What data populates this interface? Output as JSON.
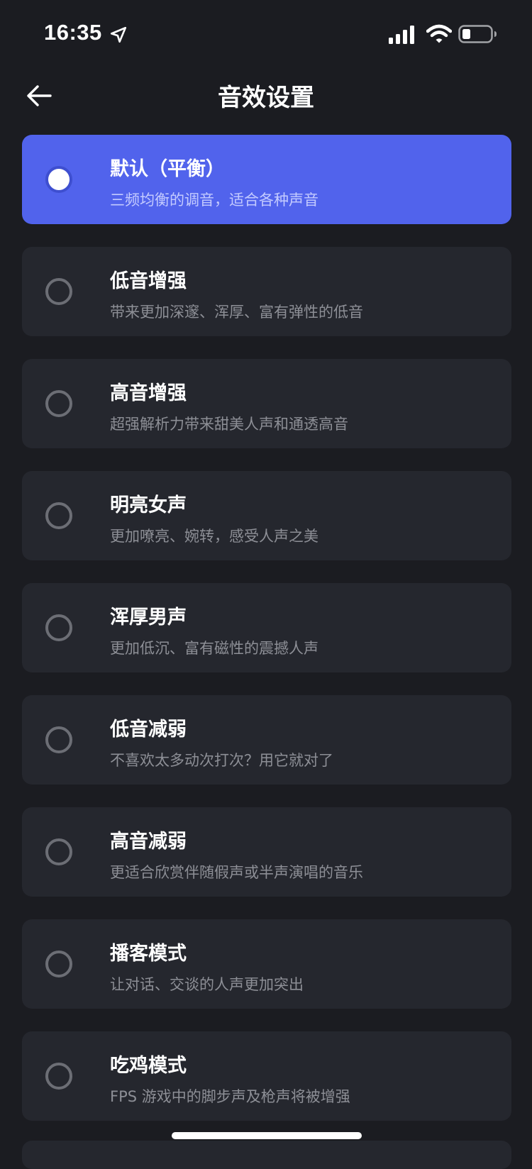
{
  "status_bar": {
    "time": "16:35",
    "icons": [
      "location-arrow-icon",
      "cellular-signal-icon",
      "wifi-icon",
      "battery-icon"
    ]
  },
  "nav": {
    "back_icon": "back-arrow-icon",
    "title": "音效设置"
  },
  "presets": [
    {
      "name": "默认（平衡）",
      "desc": "三频均衡的调音，适合各种声音",
      "selected": true
    },
    {
      "name": "低音增强",
      "desc": "带来更加深邃、浑厚、富有弹性的低音",
      "selected": false
    },
    {
      "name": "高音增强",
      "desc": "超强解析力带来甜美人声和通透高音",
      "selected": false
    },
    {
      "name": "明亮女声",
      "desc": "更加嘹亮、婉转，感受人声之美",
      "selected": false
    },
    {
      "name": "浑厚男声",
      "desc": "更加低沉、富有磁性的震撼人声",
      "selected": false
    },
    {
      "name": "低音减弱",
      "desc": "不喜欢太多动次打次？用它就对了",
      "selected": false
    },
    {
      "name": "高音减弱",
      "desc": "更适合欣赏伴随假声或半声演唱的音乐",
      "selected": false
    },
    {
      "name": "播客模式",
      "desc": "让对话、交谈的人声更加突出",
      "selected": false
    },
    {
      "name": "吃鸡模式",
      "desc": "FPS 游戏中的脚步声及枪声将被增强",
      "selected": false
    }
  ],
  "colors": {
    "background": "#1b1c21",
    "card": "#25272e",
    "selected_card": "#5163ec",
    "description_text": "#8d8f96"
  }
}
